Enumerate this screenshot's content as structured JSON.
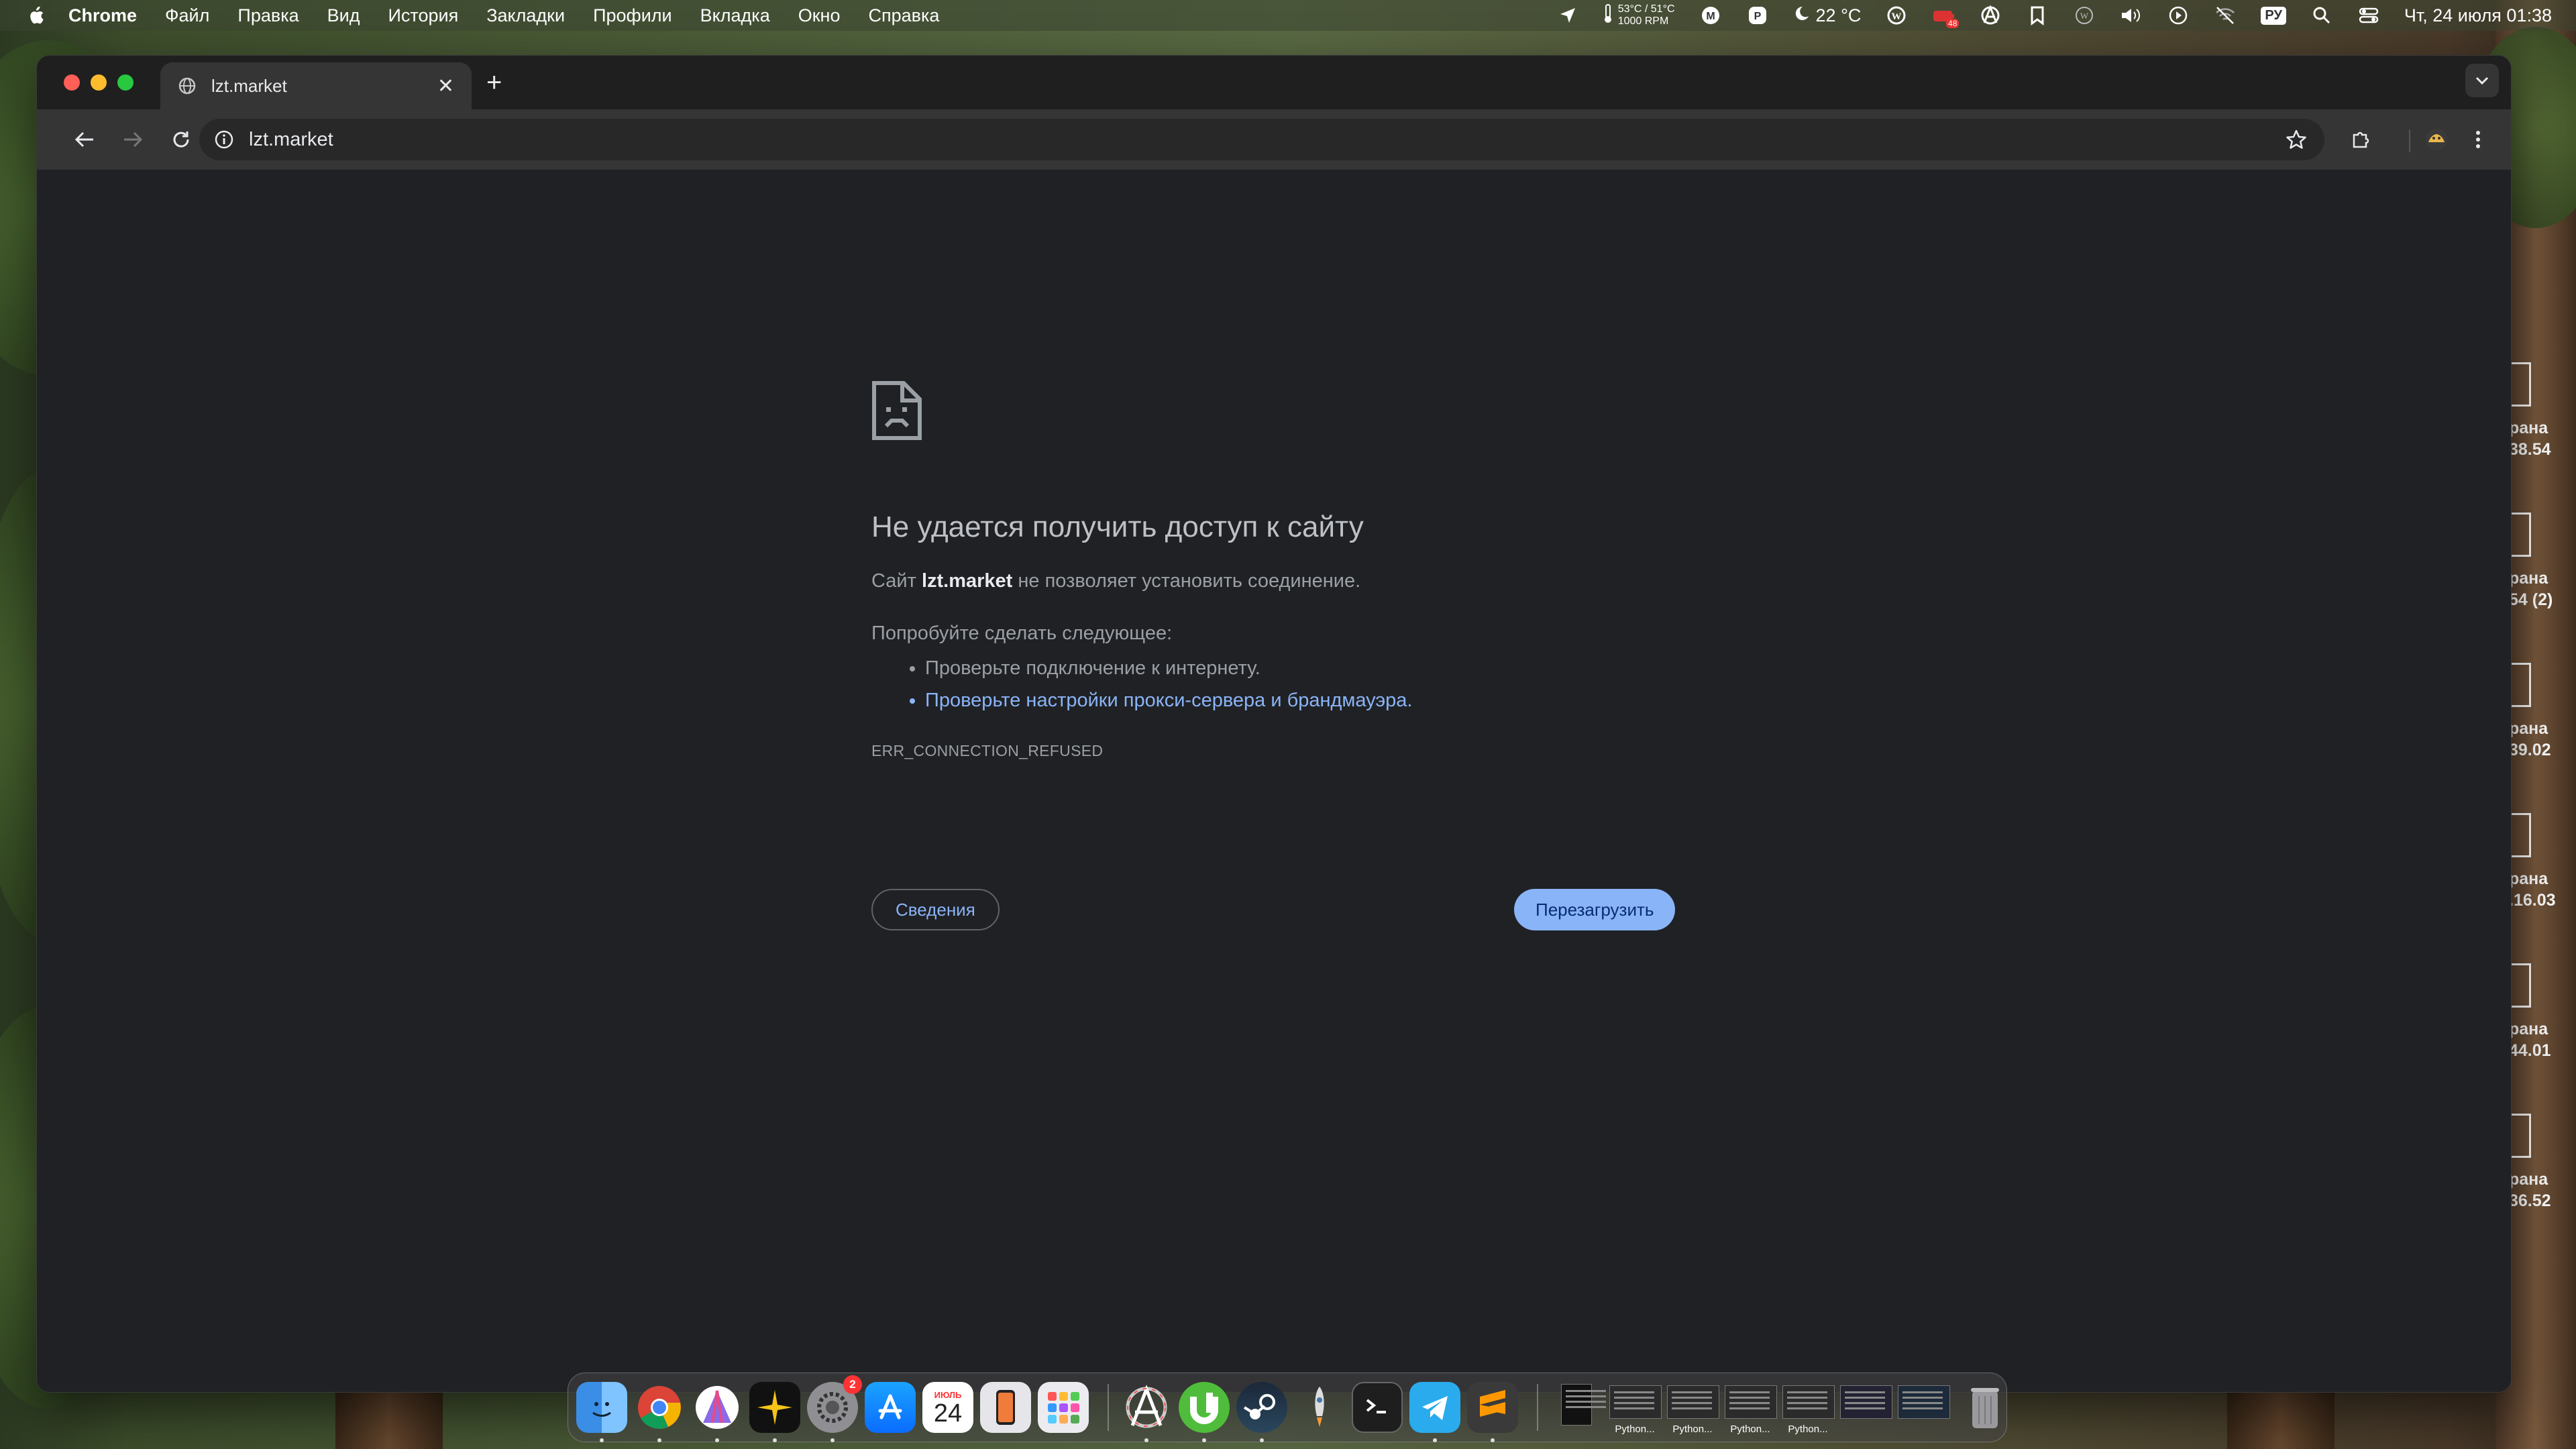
{
  "menubar": {
    "app_name": "Chrome",
    "items": [
      "Файл",
      "Правка",
      "Вид",
      "История",
      "Закладки",
      "Профили",
      "Вкладка",
      "Окно",
      "Справка"
    ],
    "sensor_line1": "53°C / 51°C",
    "sensor_line2": "1000 RPM",
    "weather": "22 °C",
    "battery_badge": "48",
    "input_source": "РУ",
    "datetime": "Чт, 24 июля  01:38"
  },
  "desktop_items": [
    {
      "l1": "рана",
      "l2": "38.54"
    },
    {
      "l1": "рана",
      "l2": "54 (2)"
    },
    {
      "l1": "рана",
      "l2": "39.02"
    },
    {
      "l1": "рана",
      "l2": ".16.03"
    },
    {
      "l1": "рана",
      "l2": "44.01"
    },
    {
      "l1": "рана",
      "l2": "36.52"
    }
  ],
  "browser": {
    "tab_title": "lzt.market",
    "url": "lzt.market"
  },
  "error_page": {
    "heading": "Не удается получить доступ к сайту",
    "p1_prefix": "Сайт ",
    "p1_host": "lzt.market",
    "p1_suffix": " не позволяет установить соединение.",
    "try_label": "Попробуйте сделать следующее:",
    "suggestion_1": "Проверьте подключение к интернету.",
    "suggestion_2": "Проверьте настройки прокси-сервера и брандмауэра.",
    "error_code": "ERR_CONNECTION_REFUSED",
    "details_button": "Сведения",
    "reload_button": "Перезагрузить"
  },
  "dock": {
    "calendar_month": "ИЮЛЬ",
    "calendar_day": "24",
    "settings_badge": "2",
    "window_captions": [
      "Python...",
      "Python...",
      "Python...",
      "Python..."
    ]
  },
  "colors": {
    "link": "#8ab4f8",
    "reload_bg": "#8ab4f8",
    "page_bg": "#202124"
  }
}
